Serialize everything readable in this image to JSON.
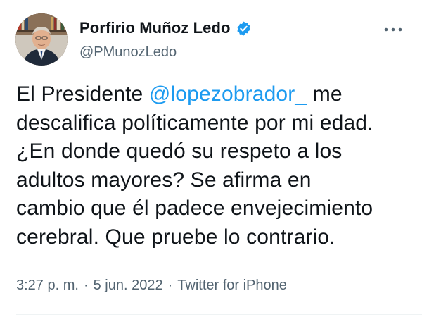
{
  "author": {
    "display_name": "Porfirio Muñoz Ledo",
    "handle": "@PMunozLedo",
    "verified_icon": "verified-badge-icon",
    "verified_color": "#1d9bf0",
    "avatar": "profile-photo"
  },
  "menu": {
    "more_icon": "more-horizontal-icon"
  },
  "tweet": {
    "lines": [
      {
        "before": "El Presidente ",
        "mention": "@lopezobrador_",
        "after": " me"
      },
      {
        "text": "descalifica políticamente por mi edad."
      },
      {
        "text": "¿En donde quedó su respeto a los"
      },
      {
        "text": "adultos mayores? Se afirma en"
      },
      {
        "text": "cambio que él padece envejecimiento"
      },
      {
        "text": "cerebral. Que pruebe lo contrario."
      }
    ],
    "mention_color": "#1d9bf0"
  },
  "meta": {
    "time": "3:27 p. m.",
    "separator": "·",
    "date": "5 jun. 2022",
    "source": "Twitter for iPhone"
  }
}
